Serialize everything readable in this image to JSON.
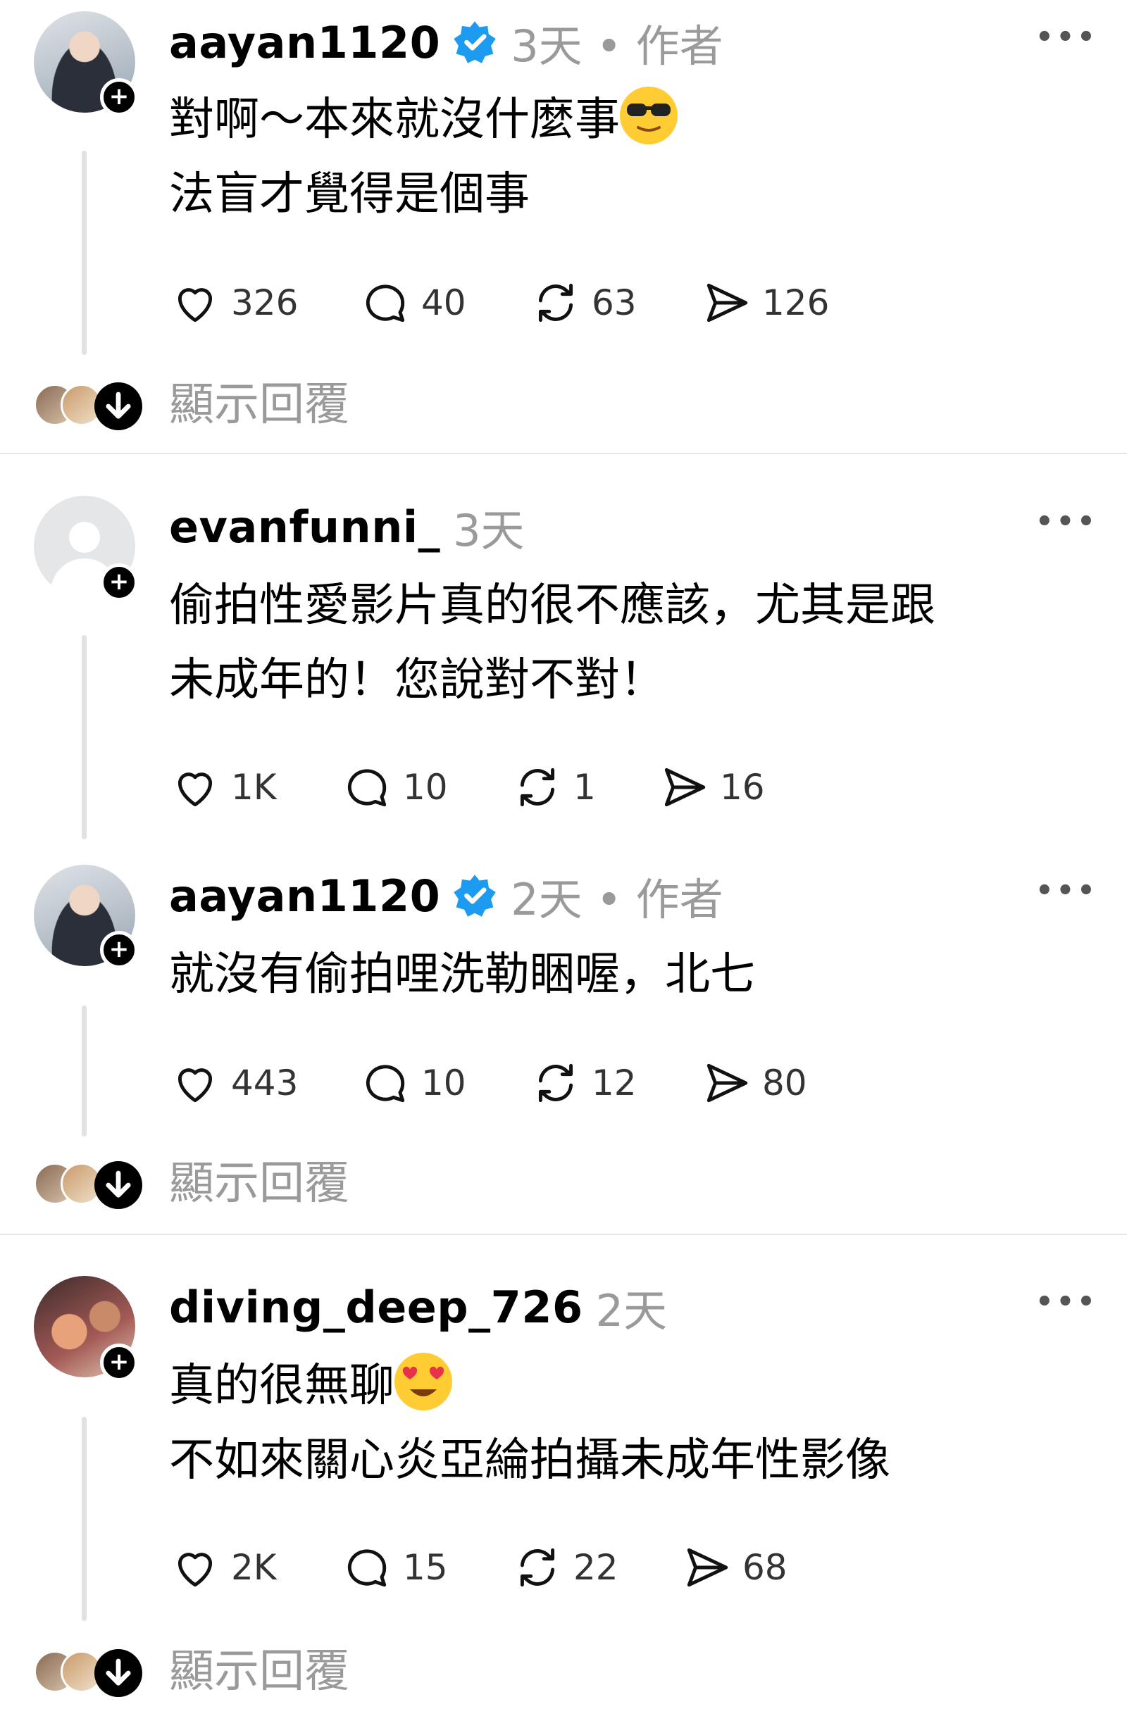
{
  "posts": [
    {
      "username": "aayan1120",
      "verified": true,
      "meta": "3天 • 作者",
      "lines": [
        "對啊～本來就沒什麼事",
        "法盲才覺得是個事"
      ],
      "emoji": "sunglasses-face",
      "likes": "326",
      "comments": "40",
      "reposts": "63",
      "shares": "126",
      "show_replies": "顯示回覆"
    },
    {
      "username": "evanfunni_",
      "verified": false,
      "meta": "3天",
      "lines": [
        "偷拍性愛影片真的很不應該，尤其是跟",
        "未成年的！您說對不對！"
      ],
      "likes": "1K",
      "comments": "10",
      "reposts": "1",
      "shares": "16"
    },
    {
      "username": "aayan1120",
      "verified": true,
      "meta": "2天 • 作者",
      "lines": [
        "就沒有偷拍哩洗勒睏喔，北七"
      ],
      "likes": "443",
      "comments": "10",
      "reposts": "12",
      "shares": "80",
      "show_replies": "顯示回覆"
    },
    {
      "username": "diving_deep_726",
      "verified": false,
      "meta": "2天",
      "lines": [
        "真的很無聊",
        "不如來關心炎亞綸拍攝未成年性影像"
      ],
      "emoji": "heart-eyes-face",
      "likes": "2K",
      "comments": "15",
      "reposts": "22",
      "shares": "68",
      "show_replies": "顯示回覆"
    }
  ],
  "colors": {
    "verified_badge": "#1d9bf0",
    "meta_text": "#9a9a9a",
    "thread_line": "#e1e1e1"
  }
}
